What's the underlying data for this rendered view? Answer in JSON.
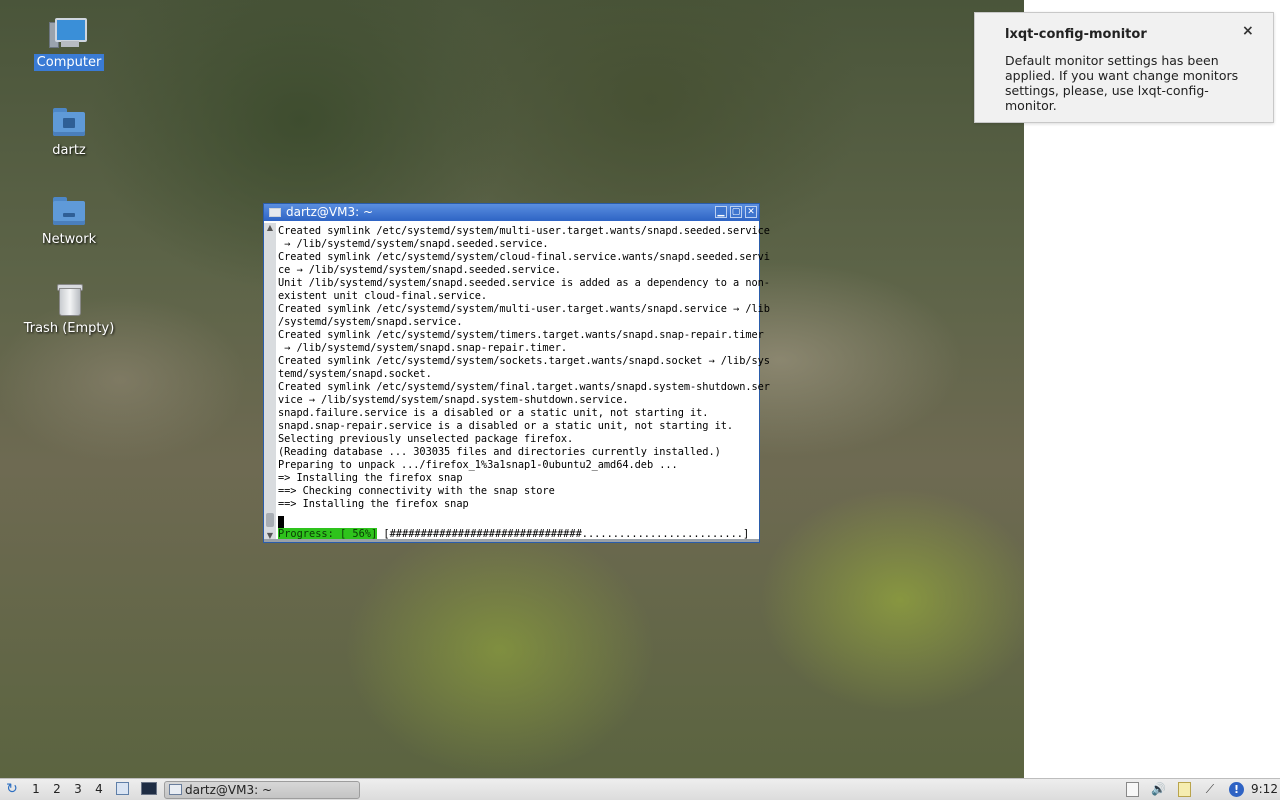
{
  "desktop": {
    "icons": [
      {
        "label": "Computer",
        "icon": "computer-icon",
        "selected": true
      },
      {
        "label": "dartz",
        "icon": "home-folder-icon"
      },
      {
        "label": "Network",
        "icon": "network-folder-icon"
      },
      {
        "label": "Trash (Empty)",
        "icon": "trash-icon"
      }
    ]
  },
  "terminal": {
    "title": "dartz@VM3: ~",
    "buttons": {
      "minimize": "▁",
      "maximize": "▢",
      "close": "✕"
    },
    "lines": [
      "Created symlink /etc/systemd/system/multi-user.target.wants/snapd.seeded.service",
      " → /lib/systemd/system/snapd.seeded.service.",
      "Created symlink /etc/systemd/system/cloud-final.service.wants/snapd.seeded.servi",
      "ce → /lib/systemd/system/snapd.seeded.service.",
      "Unit /lib/systemd/system/snapd.seeded.service is added as a dependency to a non-",
      "existent unit cloud-final.service.",
      "Created symlink /etc/systemd/system/multi-user.target.wants/snapd.service → /lib",
      "/systemd/system/snapd.service.",
      "Created symlink /etc/systemd/system/timers.target.wants/snapd.snap-repair.timer",
      " → /lib/systemd/system/snapd.snap-repair.timer.",
      "Created symlink /etc/systemd/system/sockets.target.wants/snapd.socket → /lib/sys",
      "temd/system/snapd.socket.",
      "Created symlink /etc/systemd/system/final.target.wants/snapd.system-shutdown.ser",
      "vice → /lib/systemd/system/snapd.system-shutdown.service.",
      "snapd.failure.service is a disabled or a static unit, not starting it.",
      "snapd.snap-repair.service is a disabled or a static unit, not starting it.",
      "Selecting previously unselected package firefox.",
      "(Reading database ... 303035 files and directories currently installed.)",
      "Preparing to unpack .../firefox_1%3a1snap1-0ubuntu2_amd64.deb ...",
      "=> Installing the firefox snap",
      "==> Checking connectivity with the snap store",
      "==> Installing the firefox snap"
    ],
    "progress_label": "Progress: [ 56%]",
    "progress_bar": "[###############################..........................]",
    "progress_percent": 56
  },
  "notification": {
    "title": "lxqt-config-monitor",
    "body": "Default monitor settings has been applied. If you want change monitors settings, please, use lxqt-config-monitor.",
    "close": "×"
  },
  "taskbar": {
    "menu_icon": "↻",
    "workspaces": [
      "1",
      "2",
      "3",
      "4"
    ],
    "task_label": "dartz@VM3: ~",
    "clock": "9:12",
    "tray_icons": [
      "clipboard-icon",
      "volume-icon",
      "notes-icon",
      "network-icon",
      "updates-icon"
    ],
    "volume_glyph": "🔊",
    "network_glyph": "⟋",
    "updates_glyph": "!"
  }
}
